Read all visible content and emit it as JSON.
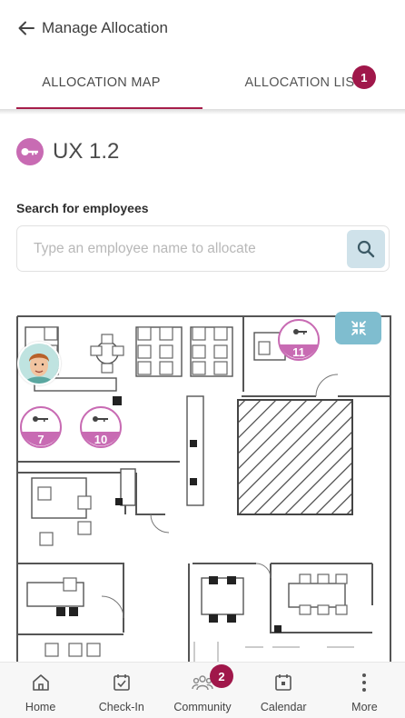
{
  "header": {
    "title": "Manage Allocation",
    "back_icon": "arrow-left-icon"
  },
  "tabs": [
    {
      "label": "ALLOCATION MAP",
      "active": true
    },
    {
      "label": "ALLOCATION LIST",
      "active": false,
      "badge": "1"
    }
  ],
  "room": {
    "name": "UX 1.2",
    "icon": "key-icon",
    "icon_color": "#c86bb3"
  },
  "search": {
    "label": "Search for employees",
    "placeholder": "Type an employee name to allocate",
    "value": "",
    "button_icon": "search-icon"
  },
  "map": {
    "desk_pins": [
      {
        "number": "11",
        "icon": "key-icon"
      },
      {
        "number": "7",
        "icon": "key-icon"
      },
      {
        "number": "10",
        "icon": "key-icon"
      }
    ],
    "collapse_icon": "collapse-icon"
  },
  "bottom_nav": [
    {
      "label": "Home",
      "icon": "home-icon"
    },
    {
      "label": "Check-In",
      "icon": "calendar-check-icon"
    },
    {
      "label": "Community",
      "icon": "people-icon",
      "badge": "2"
    },
    {
      "label": "Calendar",
      "icon": "calendar-icon"
    },
    {
      "label": "More",
      "icon": "more-vertical-icon"
    }
  ],
  "colors": {
    "accent": "#a61d4a",
    "badge": "#a0174a",
    "pin": "#c86bb3",
    "collapse_button": "#7fbdcf",
    "search_button": "#cfe2ea"
  }
}
